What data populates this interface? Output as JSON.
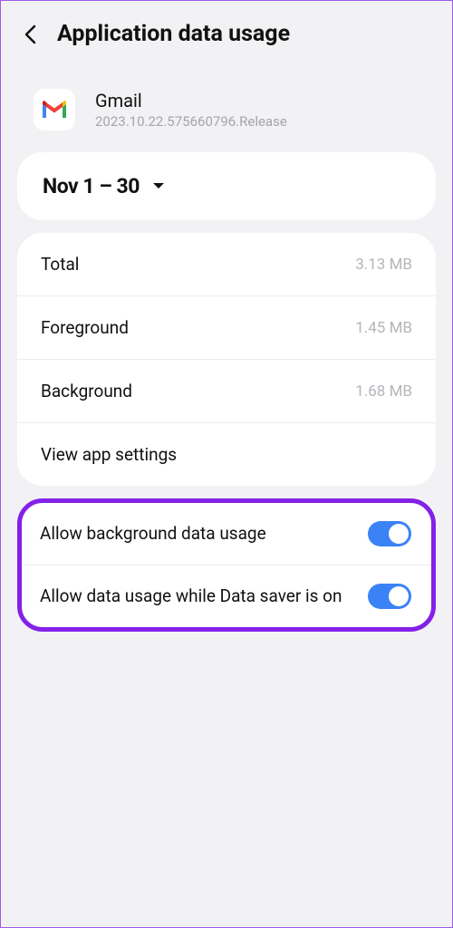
{
  "header": {
    "title": "Application data usage"
  },
  "app": {
    "name": "Gmail",
    "version": "2023.10.22.575660796.Release"
  },
  "dateRange": "Nov 1 – 30",
  "stats": {
    "total": {
      "label": "Total",
      "value": "3.13 MB"
    },
    "foreground": {
      "label": "Foreground",
      "value": "1.45 MB"
    },
    "background": {
      "label": "Background",
      "value": "1.68 MB"
    }
  },
  "viewSettings": "View app settings",
  "toggles": {
    "bgData": {
      "label": "Allow background data usage",
      "on": true
    },
    "dataSaver": {
      "label": "Allow data usage while Data saver is on",
      "on": true
    }
  }
}
